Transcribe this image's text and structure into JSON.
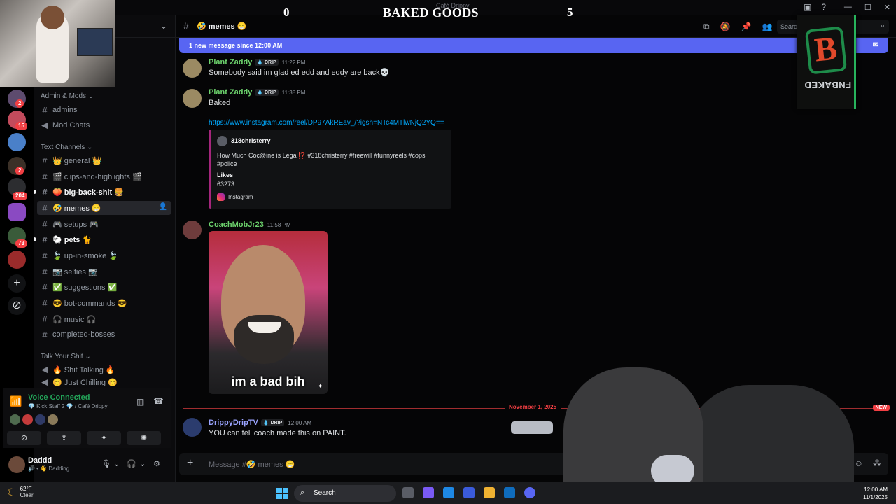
{
  "window": {
    "app_title": "Café Drippy",
    "controls": [
      "—",
      "☐",
      "✕"
    ]
  },
  "overlay": {
    "score_left": "0",
    "title": "BAKED GOODS",
    "score_right": "5",
    "logo_text": "FNBAKED",
    "logo_mark": "B"
  },
  "server_rail": {
    "badges": [
      "2",
      "15",
      "2",
      "204",
      "73"
    ],
    "add_label": "+",
    "discover_label": "⊘"
  },
  "sidebar": {
    "categories": {
      "admin": "Admin & Mods ⌄",
      "text": "Text Channels ⌄",
      "talk": "Talk Your Shit ⌄"
    },
    "channels": [
      {
        "name": "admins",
        "unread": false
      },
      {
        "name": "Mod Chats",
        "unread": false,
        "voice": true
      },
      {
        "name": "👑 general 👑",
        "unread": false
      },
      {
        "name": "🎬 clips-and-highlights 🎬",
        "unread": false
      },
      {
        "name": "🍑 big-back-shit 🍔",
        "unread": true
      },
      {
        "name": "🤣 memes 😁",
        "active": true
      },
      {
        "name": "🎮 setups 🎮",
        "unread": false
      },
      {
        "name": "🐑 pets 🐈",
        "unread": true
      },
      {
        "name": "🍃 up-in-smoke 🍃",
        "unread": false
      },
      {
        "name": "📷 selfies 📷",
        "unread": false
      },
      {
        "name": "✅ suggestions ✅",
        "unread": false
      },
      {
        "name": "😎 bot-commands 😎",
        "unread": false
      },
      {
        "name": "🎧 music 🎧",
        "unread": false
      },
      {
        "name": "completed-bosses",
        "unread": false
      },
      {
        "name": "🔥 Shit Talking 🔥",
        "unread": false,
        "voice": true
      },
      {
        "name": "😊 Just Chilling 😊",
        "unread": false,
        "voice": true
      }
    ],
    "voice": {
      "title": "Voice Connected",
      "subtitle": "💎 Kick Staff 2 💎 / Café Drippy"
    },
    "user": {
      "name": "Daddd",
      "status": "🔊 • 👋 Dadding"
    }
  },
  "main": {
    "channel_name": "🤣 memes 😁",
    "search_placeholder": "Search",
    "new_messages": "1 new message since 12:00 AM",
    "messages": [
      {
        "user": "Plant Zaddy",
        "tag": "💧 DRIP",
        "time": "11:22 PM",
        "color": "#6dd36d",
        "text": "Somebody said im glad ed edd and eddy are back💀"
      },
      {
        "user": "Plant Zaddy",
        "tag": "💧 DRIP",
        "time": "11:38 PM",
        "color": "#6dd36d",
        "text": "Baked"
      },
      {
        "user": "CoachMobJr23",
        "time": "11:58 PM",
        "color": "#6dd36d"
      },
      {
        "user": "DrippyDripTV",
        "tag": "💧 DRIP",
        "time": "12:00 AM",
        "color": "#9aa4ff",
        "text": "YOU can tell coach made this on PAINT."
      }
    ],
    "link": "https://www.instagram.com/reel/DP97AkREav_/?igsh=NTc4MTlwNjQ2YQ==",
    "embed": {
      "author": "318christerry",
      "description": "How Much Coc@ine is Legal⁉️ #318christerry #freewill #funnyreels #cops #police",
      "field_name": "Likes",
      "field_value": "63273",
      "footer": "Instagram",
      "border_color": "#a5267c"
    },
    "image_caption": "im a bad bih",
    "date_divider": "November 1, 2025",
    "new_badge": "NEW",
    "composer_placeholder": "Message #🤣 memes 😁"
  },
  "taskbar": {
    "temp": "62°F",
    "weather": "Clear",
    "search": "Search",
    "time": "12:00 AM",
    "date": "11/1/2025"
  },
  "colors": {
    "accent": "#5865f2",
    "online": "#23a559",
    "danger": "#f23f43",
    "link": "#00a8fc"
  }
}
